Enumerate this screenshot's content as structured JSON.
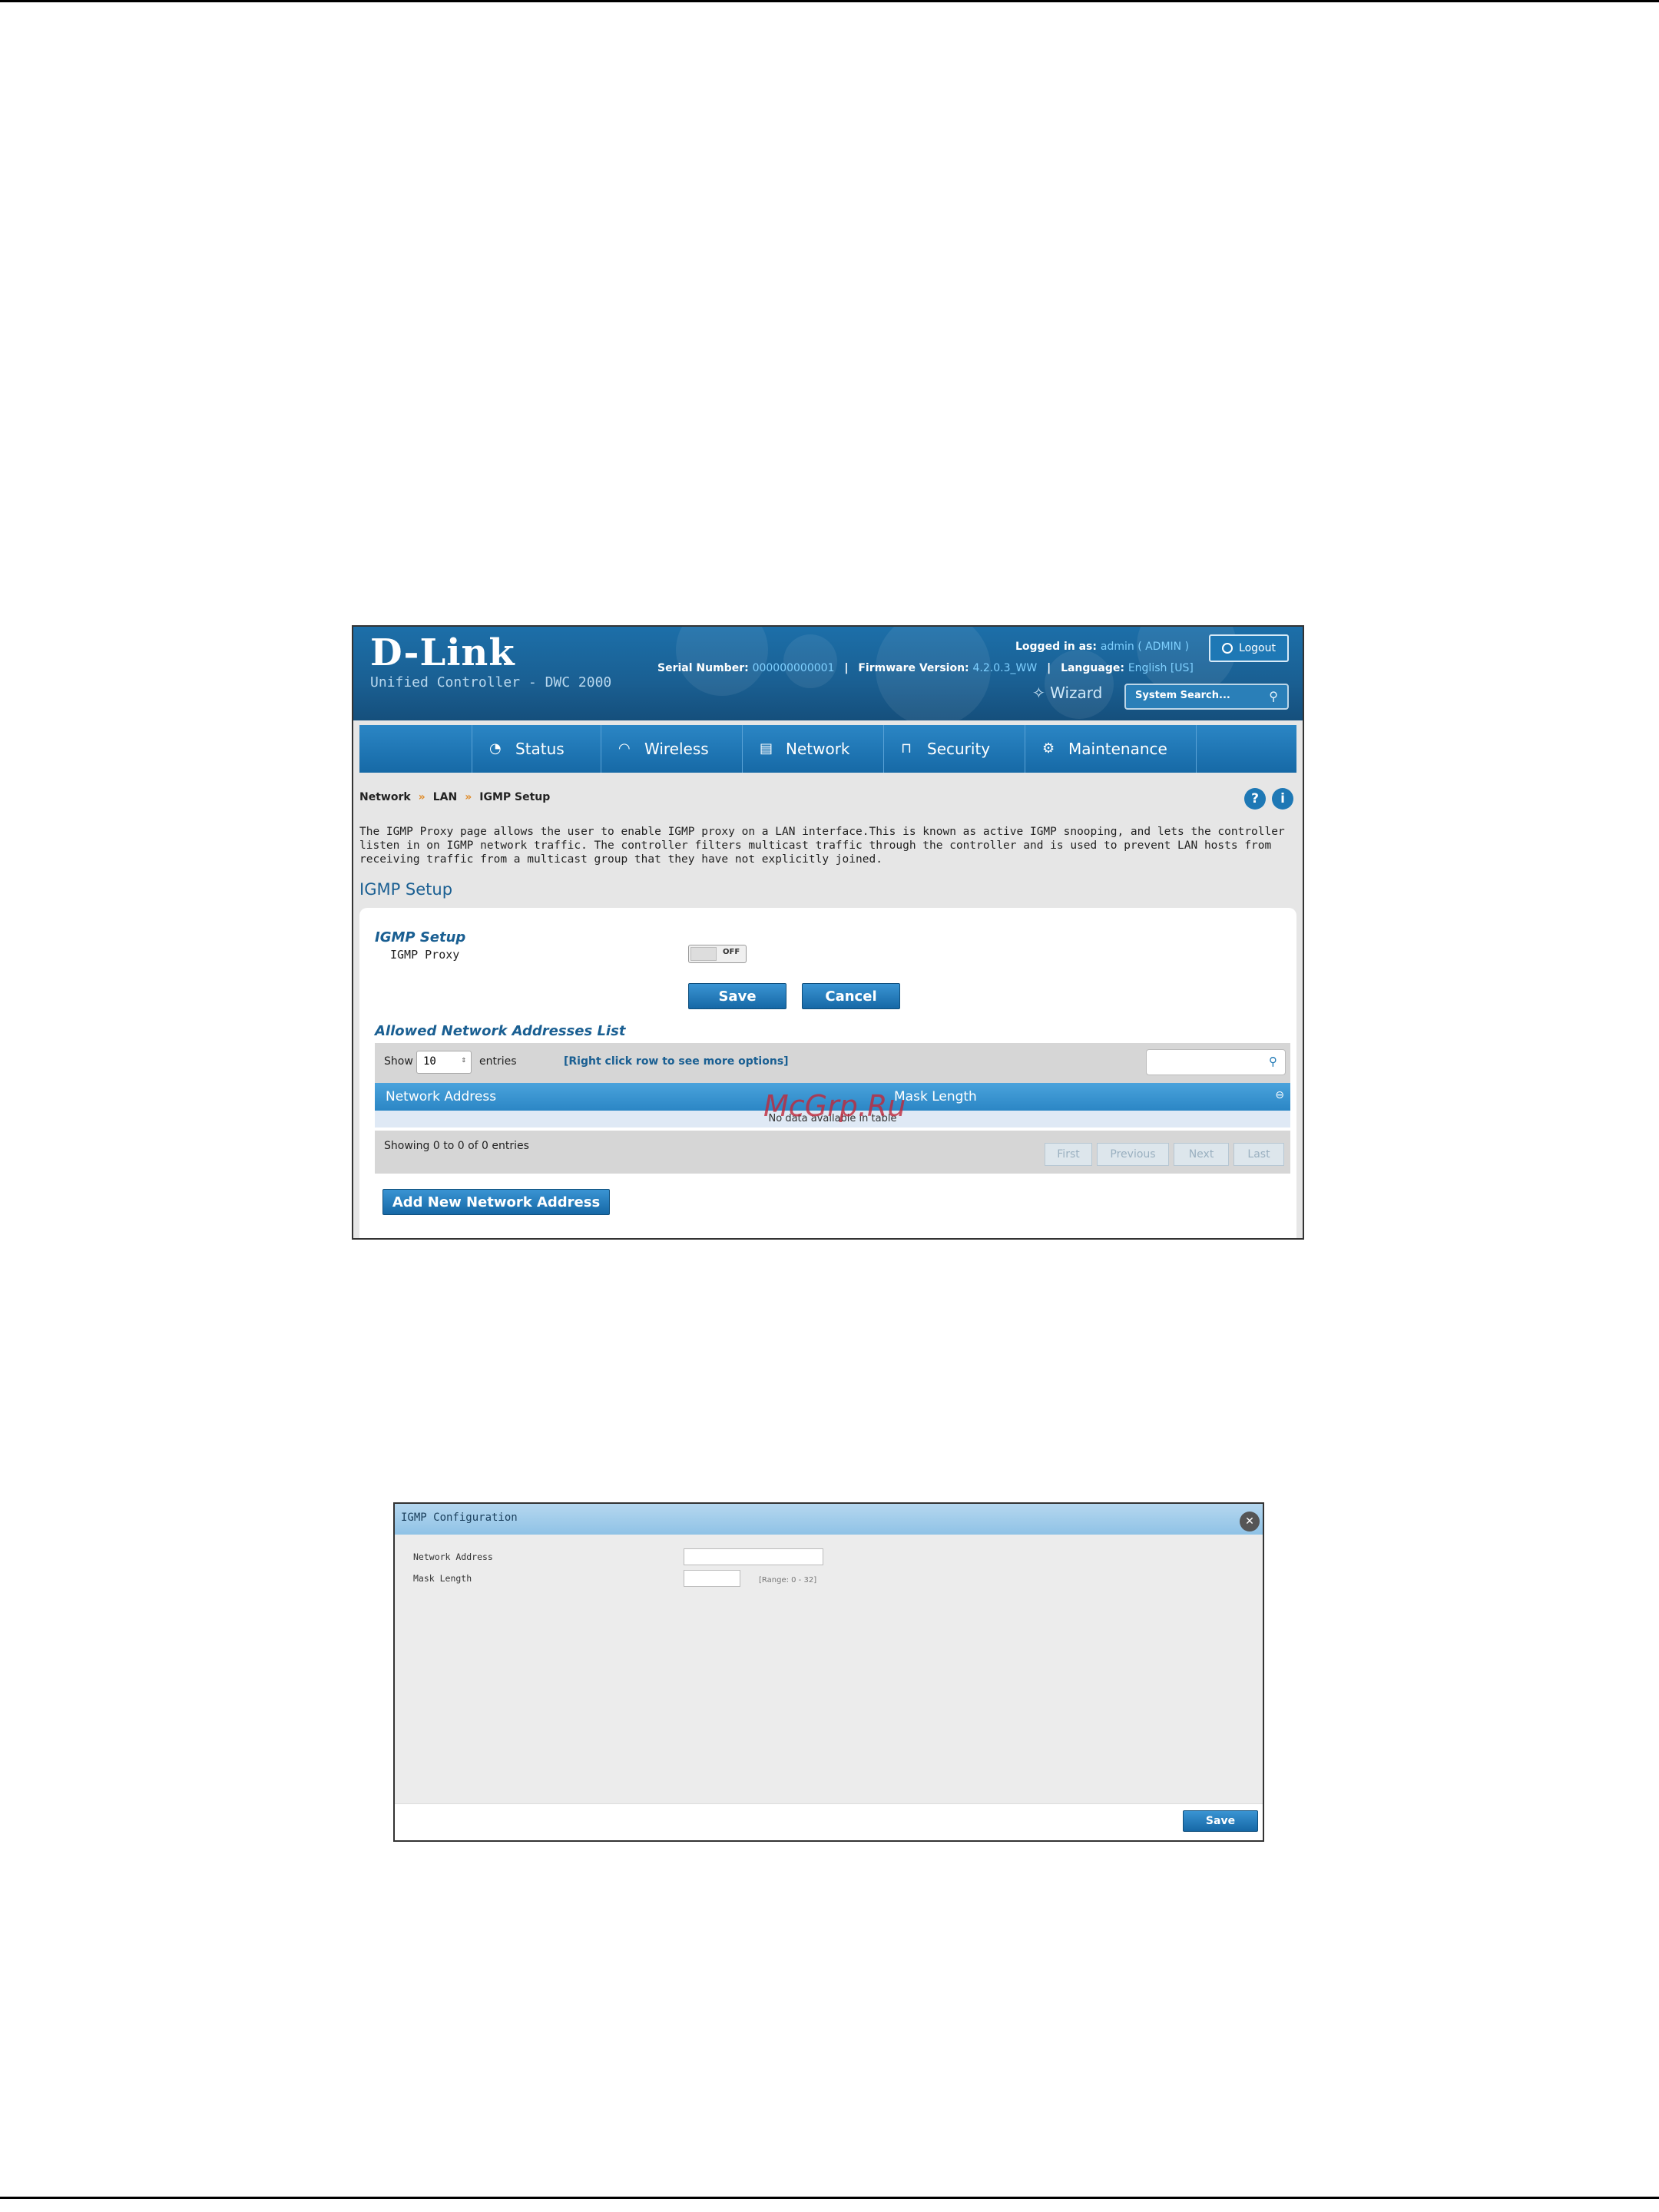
{
  "header": {
    "brand": "D-Link",
    "subtitle": "Unified Controller - DWC 2000",
    "logged_in_label": "Logged in as:",
    "logged_in_user": "admin ( ADMIN )",
    "logout_label": "Logout",
    "serial_label": "Serial Number:",
    "serial_value": "000000000001",
    "firmware_label": "Firmware Version:",
    "firmware_value": "4.2.0.3_WW",
    "language_label": "Language:",
    "language_value": "English [US]",
    "wizard_label": "Wizard",
    "search_placeholder": "System Search..."
  },
  "nav": {
    "items": [
      {
        "label": "Status",
        "icon": "gauge-icon"
      },
      {
        "label": "Wireless",
        "icon": "wifi-icon"
      },
      {
        "label": "Network",
        "icon": "network-icon"
      },
      {
        "label": "Security",
        "icon": "lock-icon"
      },
      {
        "label": "Maintenance",
        "icon": "gears-icon"
      }
    ]
  },
  "breadcrumb": {
    "items": [
      "Network",
      "LAN",
      "IGMP Setup"
    ],
    "separator": "»"
  },
  "description": "The IGMP Proxy page allows the user to enable IGMP proxy on a LAN interface.This is known as active IGMP snooping, and lets the controller listen in on IGMP network traffic. The controller filters multicast traffic through the controller and is used to prevent LAN hosts from receiving traffic from a multicast group that they have not explicitly joined.",
  "page_title": "IGMP Setup",
  "form": {
    "section_title": "IGMP Setup",
    "proxy_label": "IGMP Proxy",
    "proxy_state": "OFF",
    "save_label": "Save",
    "cancel_label": "Cancel"
  },
  "allowed_list": {
    "title": "Allowed Network Addresses List",
    "show_label": "Show",
    "page_size": "10",
    "entries_label": "entries",
    "hint": "[Right click row to see more options]",
    "columns": [
      "Network Address",
      "Mask Length"
    ],
    "empty_text": "No data available in table",
    "showing_text": "Showing 0 to 0 of 0 entries",
    "pager": [
      "First",
      "Previous",
      "Next",
      "Last"
    ],
    "add_label": "Add New Network Address"
  },
  "watermark": "McGrp.Ru",
  "dialog": {
    "title": "IGMP Configuration",
    "fields": [
      {
        "label": "Network Address",
        "value": ""
      },
      {
        "label": "Mask Length",
        "value": "",
        "hint": "[Range: 0 - 32]"
      }
    ],
    "save_label": "Save"
  },
  "colors": {
    "header_blue": "#1a5f92",
    "nav_blue": "#2b86c5",
    "link_blue": "#7fd0ff",
    "accent_orange": "#e08c2a"
  }
}
